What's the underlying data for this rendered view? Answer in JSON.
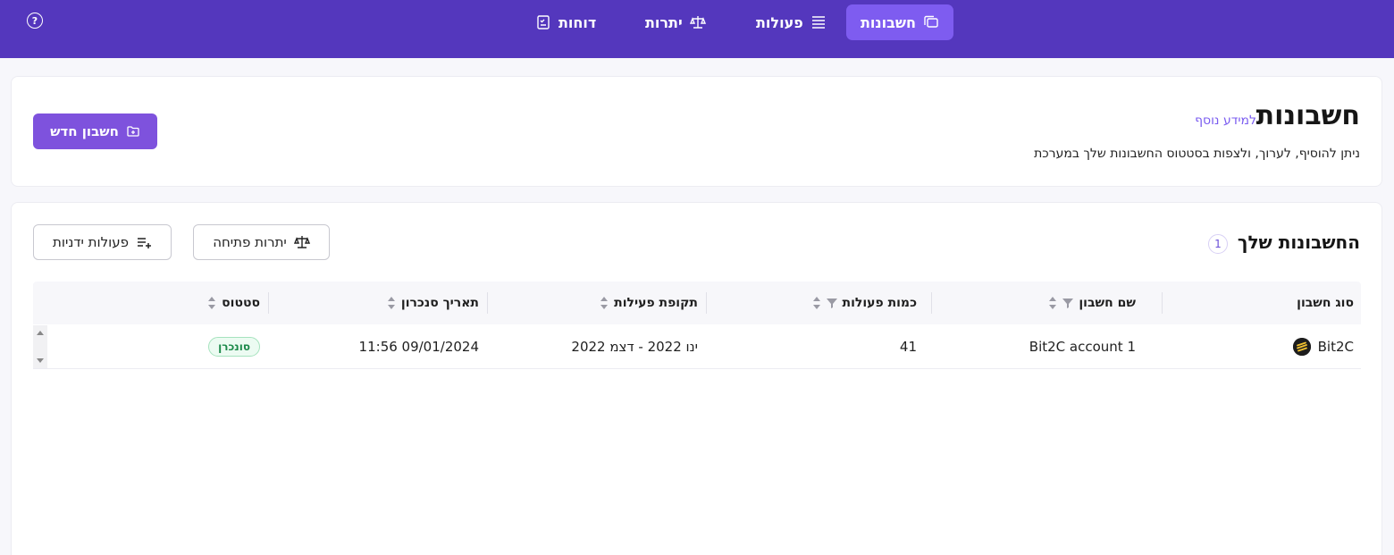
{
  "topbar": {
    "nav": [
      {
        "label": "חשבונות",
        "icon": "folders-icon",
        "active": true
      },
      {
        "label": "פעולות",
        "icon": "list-icon",
        "active": false
      },
      {
        "label": "יתרות",
        "icon": "scale-icon",
        "active": false
      },
      {
        "label": "דוחות",
        "icon": "report-icon",
        "active": false
      }
    ],
    "help_symbol": "?"
  },
  "header": {
    "title": "חשבונות",
    "learn_more": "למידע נוסף",
    "subtitle": "ניתן להוסיף, לערוך, ולצפות בסטטוס החשבונות שלך במערכת",
    "new_account_label": "חשבון חדש"
  },
  "accounts": {
    "title": "החשבונות שלך",
    "count": "1",
    "opening_balances_label": "יתרות פתיחה",
    "manual_actions_label": "פעולות ידניות",
    "columns": {
      "account_type": "סוג חשבון",
      "account_name": "שם חשבון",
      "actions_count": "כמות פעולות",
      "activity_period": "תקופת פעילות",
      "sync_date": "תאריך סנכרון",
      "status": "סטטוס"
    },
    "rows": [
      {
        "account_type": "Bit2C",
        "account_name": "Bit2C account 1",
        "actions_count": "41",
        "activity_period": "ינו 2022 - דצמ 2022",
        "sync_date": "11:56 09/01/2024",
        "status": "סונכרן"
      }
    ]
  },
  "colors": {
    "topbar": "#5437bd",
    "accent": "#7e52dd",
    "status_ok": "#1c8a4a"
  }
}
